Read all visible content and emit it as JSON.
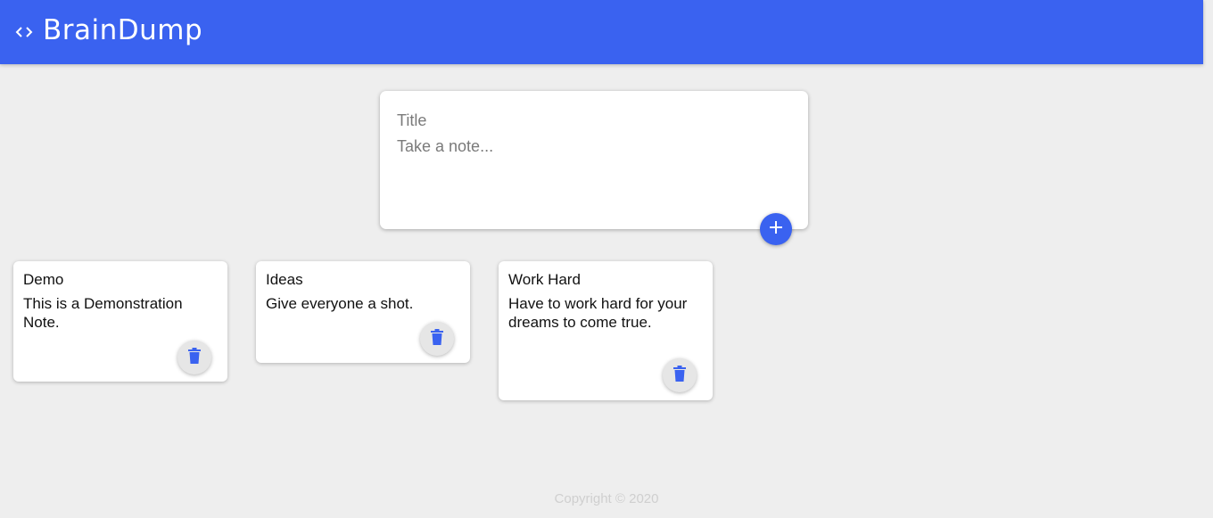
{
  "app": {
    "title": "BrainDump",
    "brand_color": "#3a62f0"
  },
  "composer": {
    "title_placeholder": "Title",
    "content_placeholder": "Take a note...",
    "add_icon": "plus-icon"
  },
  "notes": [
    {
      "title": "Demo",
      "content": "This is a Demonstration Note.",
      "delete_icon": "trash-icon"
    },
    {
      "title": "Ideas",
      "content": "Give everyone a shot.",
      "delete_icon": "trash-icon"
    },
    {
      "title": "Work Hard",
      "content": "Have to work hard for your dreams to come true.",
      "delete_icon": "trash-icon"
    }
  ],
  "footer": {
    "copyright": "Copyright © 2020"
  }
}
